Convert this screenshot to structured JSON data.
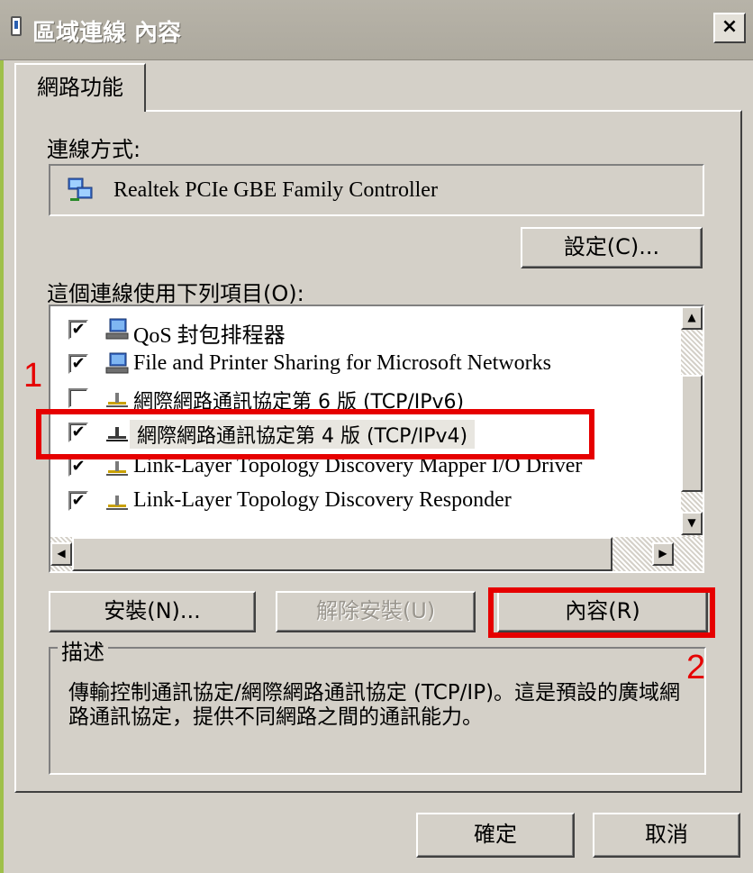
{
  "window": {
    "title": "區域連線 內容",
    "close_label": "×"
  },
  "tabs": [
    {
      "label": "網路功能",
      "active": true
    }
  ],
  "connect_using": {
    "label": "連線方式:",
    "adapter_name": "Realtek PCIe GBE Family Controller",
    "configure_button": "設定(C)..."
  },
  "items": {
    "label": "這個連線使用下列項目(O):",
    "list": [
      {
        "label": "QoS 封包排程器",
        "checked": true,
        "icon": "network-client-icon"
      },
      {
        "label": "File and Printer Sharing for Microsoft Networks",
        "checked": true,
        "icon": "network-client-icon"
      },
      {
        "label": "網際網路通訊協定第 6 版 (TCP/IPv6)",
        "checked": false,
        "icon": "protocol-icon"
      },
      {
        "label": "網際網路通訊協定第 4 版 (TCP/IPv4)",
        "checked": true,
        "icon": "protocol-icon",
        "selected": true
      },
      {
        "label": "Link-Layer Topology Discovery Mapper I/O Driver",
        "checked": true,
        "icon": "protocol-icon"
      },
      {
        "label": "Link-Layer Topology Discovery Responder",
        "checked": true,
        "icon": "protocol-icon"
      }
    ]
  },
  "buttons": {
    "install": "安裝(N)...",
    "uninstall": "解除安裝(U)",
    "properties": "內容(R)",
    "ok": "確定",
    "cancel": "取消"
  },
  "description": {
    "legend": "描述",
    "text": "傳輸控制通訊協定/網際網路通訊協定 (TCP/IP)。這是預設的廣域網路通訊協定，提供不同網路之間的通訊能力。"
  },
  "annotations": [
    {
      "number": "1",
      "target": "網際網路通訊協定第 4 版 (TCP/IPv4)"
    },
    {
      "number": "2",
      "target": "內容(R)"
    }
  ],
  "colors": {
    "annotation": "#e60000",
    "dialog_bg": "#d4d0c8"
  }
}
